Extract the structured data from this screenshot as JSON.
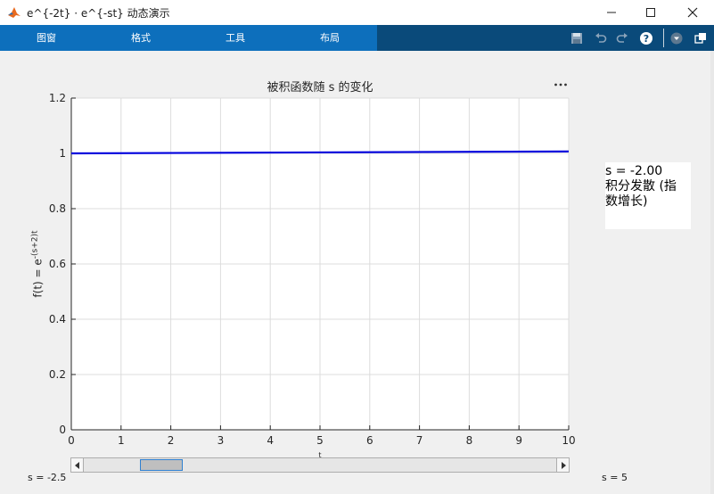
{
  "window": {
    "title": "e^{-2t} · e^{-st} 动态演示"
  },
  "toolstrip": {
    "tabs": [
      {
        "label": "图窗"
      },
      {
        "label": "格式"
      },
      {
        "label": "工具"
      },
      {
        "label": "布局"
      }
    ],
    "icons": [
      "save-icon",
      "undo-icon",
      "redo-icon",
      "help-icon",
      "expand-icon",
      "undock-icon"
    ]
  },
  "axes": {
    "title": "被积函数随 s 的变化",
    "ylabel_base": "f(t) = e",
    "ylabel_exp": "-(s+2)t",
    "xlabel": "t"
  },
  "annotation": {
    "line1": "s = -2.00",
    "line2": "积分发散 (指",
    "line3": "数增长)"
  },
  "slider": {
    "min_label": "s = -2.5",
    "max_label": "s = 5",
    "min": -2.5,
    "max": 5,
    "value": -2
  },
  "chart_data": {
    "type": "line",
    "xlim": [
      0,
      10
    ],
    "ylim": [
      0,
      1.2
    ],
    "xticks": [
      "0",
      "1",
      "2",
      "3",
      "4",
      "5",
      "6",
      "7",
      "8",
      "9",
      "10"
    ],
    "yticks": [
      "0",
      "0.2",
      "0.4",
      "0.6",
      "0.8",
      "1",
      "1.2"
    ],
    "grid": true,
    "series": [
      {
        "x": [
          0,
          10
        ],
        "y": [
          1,
          1.007
        ],
        "color": "#0000dd"
      }
    ]
  }
}
